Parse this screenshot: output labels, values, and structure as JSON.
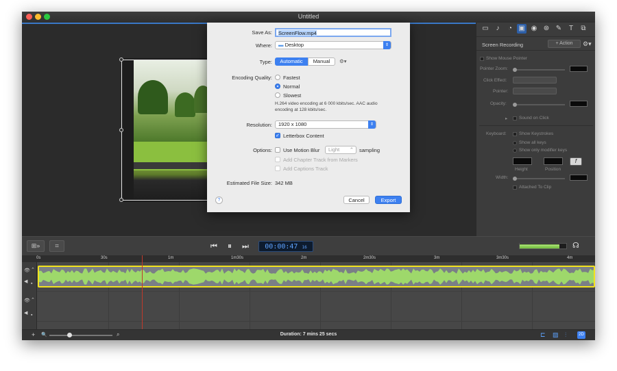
{
  "window": {
    "title": "Untitled"
  },
  "dialog": {
    "save_as_label": "Save As:",
    "save_as_value": "ScreenFlow.mp4",
    "where_label": "Where:",
    "where_value": "Desktop",
    "type_label": "Type:",
    "type_options": [
      "Automatic",
      "Manual"
    ],
    "type_selected": "Automatic",
    "encoding_label": "Encoding Quality:",
    "quality_options": [
      "Fastest",
      "Normal",
      "Slowest"
    ],
    "quality_selected": "Normal",
    "encoding_info_line1": "H.264 video encoding at 6 000 kbits/sec.  AAC audio",
    "encoding_info_line2": "encoding at 128 kbits/sec.",
    "resolution_label": "Resolution:",
    "resolution_value": "1920 x 1080",
    "letterbox_label": "Letterbox Content",
    "letterbox_checked": true,
    "options_label": "Options:",
    "motion_blur_label": "Use Motion Blur",
    "motion_blur_level": "Light",
    "sampling_label": "sampling",
    "chapter_track_label": "Add Chapter Track from Markers",
    "captions_track_label": "Add Captions Track",
    "file_size_label": "Estimated File Size:",
    "file_size_value": "342 MB",
    "help_label": "?",
    "cancel_label": "Cancel",
    "export_label": "Export"
  },
  "inspector": {
    "title": "Screen Recording",
    "action_label": "+ Action",
    "show_mouse_pointer": "Show Mouse Pointer",
    "pointer_zoom": "Pointer Zoom:",
    "click_effect": "Click Effect:",
    "pointer": "Pointer:",
    "opacity": "Opacity:",
    "sound_on_click": "Sound on Click",
    "keyboard": "Keyboard:",
    "show_keystrokes": "Show Keystrokes",
    "show_all_keys": "Show all keys",
    "show_modifier_keys": "Show only modifier keys",
    "height": "Height",
    "position": "Position",
    "width": "Width:",
    "attached_to_clip": "Attached To Clip",
    "font_glyph": "f"
  },
  "transport": {
    "timecode": "00:00:47",
    "frames": "16"
  },
  "ruler": {
    "labels": [
      "0s",
      "30s",
      "1m",
      "1m30s",
      "2m",
      "2m30s",
      "3m",
      "3m30s",
      "4m"
    ]
  },
  "status": {
    "duration": "Duration: 7 mins 25 secs",
    "zoom_badge": "2D"
  },
  "colors": {
    "accent_blue": "#3d80f0",
    "clip_selection": "#f2e21d",
    "playhead": "#c0392b",
    "audio_wave": "#9ed86b"
  }
}
